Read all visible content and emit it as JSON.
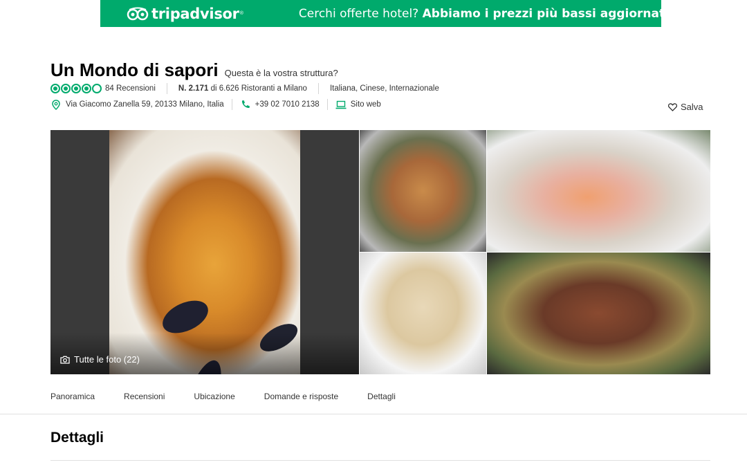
{
  "banner": {
    "brand": "tripadvisor",
    "promo_prefix": "Cerchi offerte hotel?",
    "promo_bold": "Abbiamo i prezzi più bassi aggiornati"
  },
  "restaurant": {
    "name": "Un Mondo di sapori",
    "claim_link": "Questa è la vostra struttura?",
    "rating_bubbles": 4,
    "rating_max": 5,
    "reviews": "84 Recensioni",
    "rank_bold": "N. 2.171",
    "rank_rest": "di 6.626 Ristoranti a Milano",
    "cuisines": "Italiana, Cinese, Internazionale",
    "address": "Via Giacomo Zanella 59, 20133 Milano, Italia",
    "phone": "+39 02 7010 2138",
    "website": "Sito web",
    "save": "Salva"
  },
  "photos": {
    "all_photos": "Tutte le foto (22)"
  },
  "tabs": [
    "Panoramica",
    "Recensioni",
    "Ubicazione",
    "Domande e risposte",
    "Dettagli"
  ],
  "section": {
    "title": "Dettagli"
  },
  "colors": {
    "brand": "#00aa6c",
    "text": "#333333"
  }
}
